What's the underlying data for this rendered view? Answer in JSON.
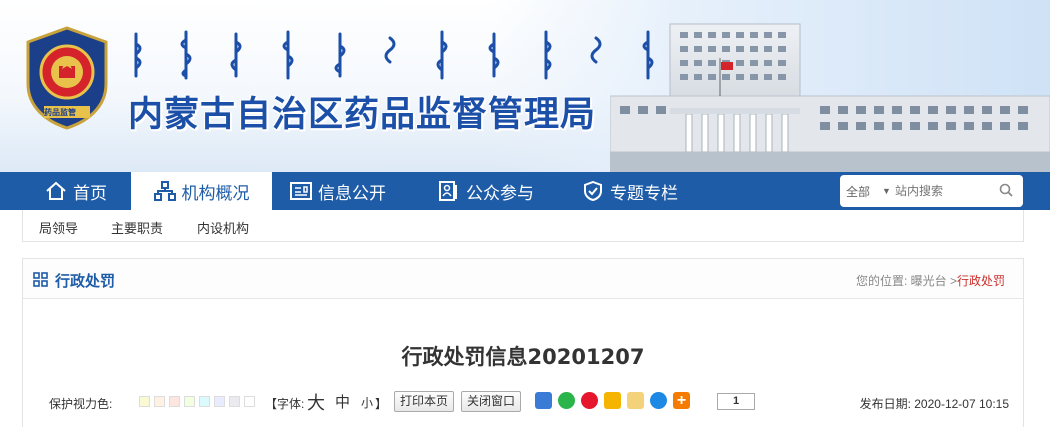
{
  "header": {
    "title": "内蒙古自治区药品监督管理局",
    "emblem_text": "药品监管"
  },
  "nav": {
    "items": [
      {
        "label": "首页",
        "icon": "home-icon"
      },
      {
        "label": "机构概况",
        "icon": "org-chart-icon",
        "active": true
      },
      {
        "label": "信息公开",
        "icon": "news-icon"
      },
      {
        "label": "公众参与",
        "icon": "people-icon"
      },
      {
        "label": "专题专栏",
        "icon": "shield-check-icon"
      }
    ],
    "search": {
      "scope": "全部",
      "placeholder": "站内搜索"
    }
  },
  "subnav": {
    "items": [
      "局领导",
      "主要职责",
      "内设机构"
    ]
  },
  "section": {
    "title": "行政处罚",
    "breadcrumb": {
      "prefix": "您的位置: 曝光台 >",
      "current": "行政处罚"
    }
  },
  "article": {
    "title": "行政处罚信息20201207",
    "tools": {
      "color_label": "保护视力色:",
      "swatches": [
        "#fafad2",
        "#fff2e2",
        "#fde6e0",
        "#f3ffe1",
        "#daFaFe",
        "#e9ebfe",
        "#eaeaef",
        "#ffffff"
      ],
      "font_label": "【字体:",
      "font_large": "大",
      "font_medium": "中",
      "font_small": "小",
      "font_end": "】",
      "print_label": "打印本页",
      "close_label": "关闭窗口",
      "share_count": "1"
    },
    "publish": {
      "label": "发布日期:",
      "date": "2020-12-07 10:15"
    }
  },
  "colors": {
    "brand": "#1e5ca8",
    "accent_red": "#c9302c"
  }
}
